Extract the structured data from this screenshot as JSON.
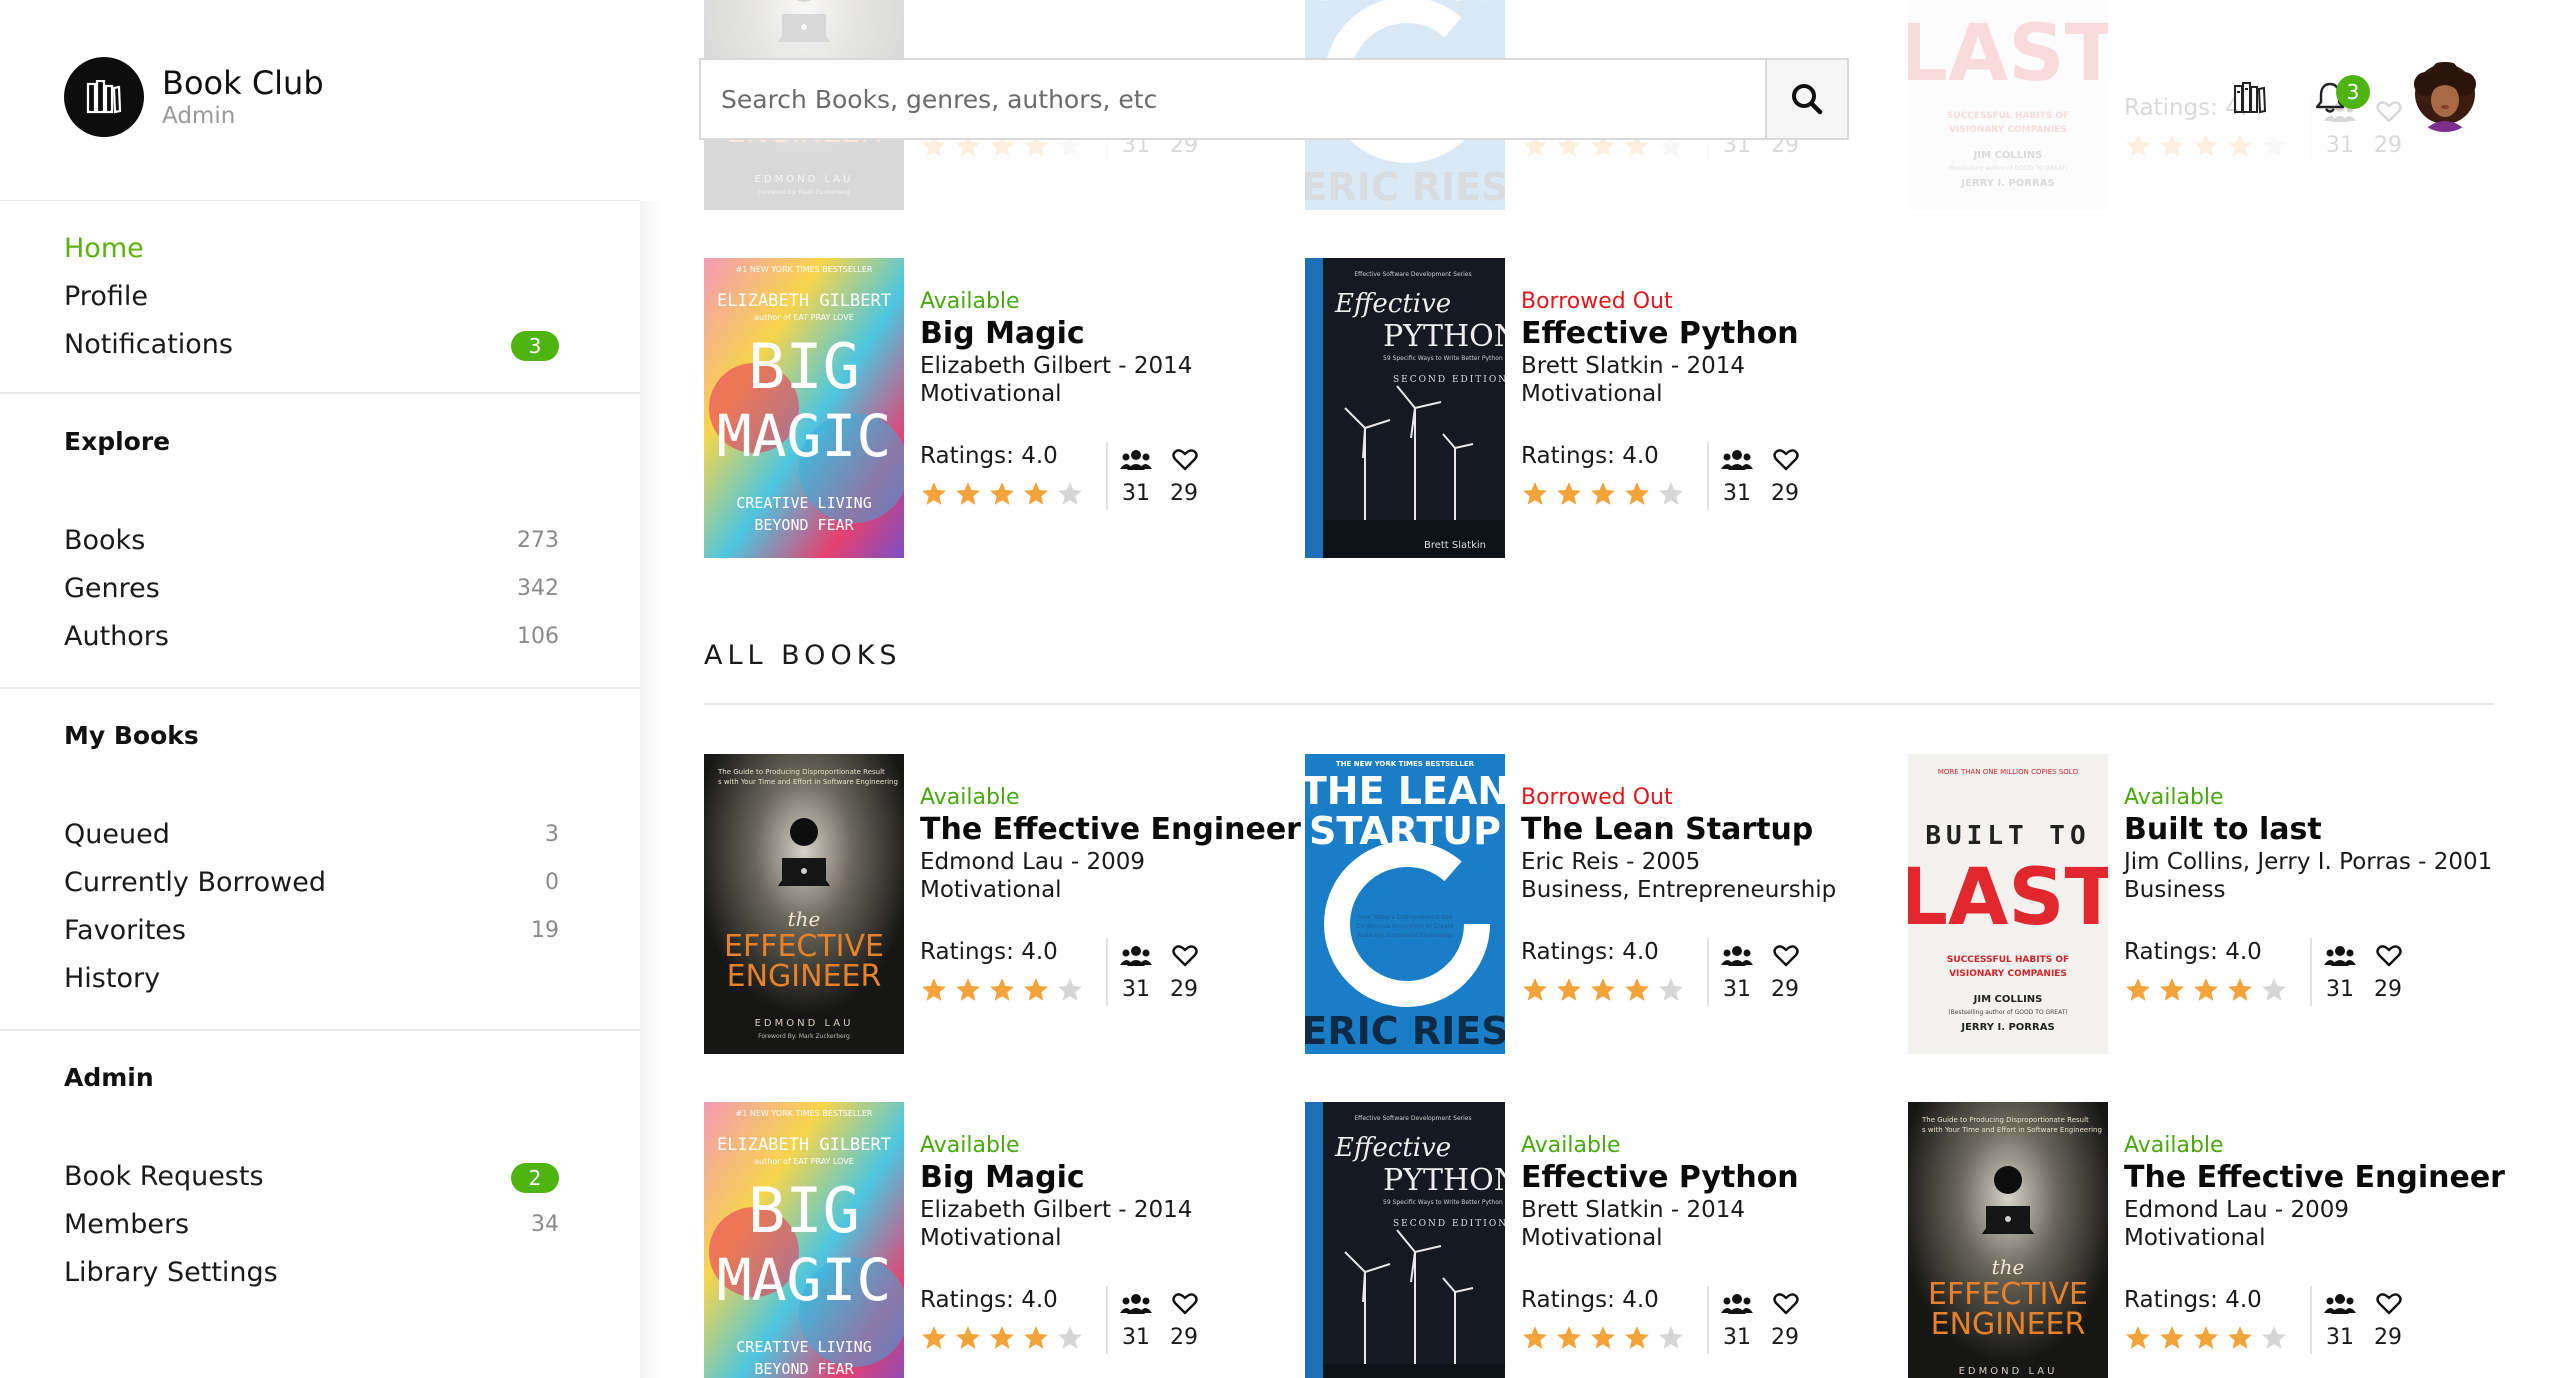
{
  "brand": {
    "name": "Book Club",
    "role": "Admin"
  },
  "search": {
    "placeholder": "Search Books, genres, authors, etc"
  },
  "header": {
    "notification_badge": "3"
  },
  "sidebar": {
    "main": [
      {
        "label": "Home",
        "active": true
      },
      {
        "label": "Profile"
      },
      {
        "label": "Notifications",
        "badge": "3"
      }
    ],
    "explore": {
      "heading": "Explore",
      "items": [
        {
          "label": "Books",
          "count": "273"
        },
        {
          "label": "Genres",
          "count": "342"
        },
        {
          "label": "Authors",
          "count": "106"
        }
      ]
    },
    "my_books": {
      "heading": "My Books",
      "items": [
        {
          "label": "Queued",
          "count": "3"
        },
        {
          "label": "Currently Borrowed",
          "count": "0"
        },
        {
          "label": "Favorites",
          "count": "19"
        },
        {
          "label": "History",
          "count": ""
        }
      ]
    },
    "admin": {
      "heading": "Admin",
      "items": [
        {
          "label": "Book Requests",
          "badge": "2"
        },
        {
          "label": "Members",
          "count": "34"
        },
        {
          "label": "Library Settings",
          "count": ""
        }
      ]
    }
  },
  "section": {
    "all_books": "ALL BOOKS"
  },
  "colors": {
    "accent": "#4fb310",
    "available": "#49a90c",
    "borrowed": "#e5171d",
    "star": "#f2a33a"
  },
  "books": [
    {
      "cover": "engineer",
      "status": "",
      "title": "",
      "author_year": "Edmond Lau - 2009",
      "genre": "Motivational",
      "ratings_label": "",
      "rating": 4,
      "borrows": "31",
      "likes": "29"
    },
    {
      "cover": "startup",
      "status": "",
      "title": "",
      "author_year": "Eric Reis - 2005",
      "genre": "Business, Entrepreneurship",
      "ratings_label": "",
      "rating": 4,
      "borrows": "31",
      "likes": "29"
    },
    {
      "cover": "last",
      "status": "",
      "title": "",
      "author_year": "Jim Collins, Jerry I. Porras - 2001",
      "genre": "Business",
      "ratings_label": "Ratings: 4.",
      "rating": 4,
      "borrows": "31",
      "likes": "29"
    },
    {
      "cover": "magic",
      "status": "Available",
      "status_type": "available",
      "title": "Big Magic",
      "author_year": "Elizabeth Gilbert - 2014",
      "genre": "Motivational",
      "ratings_label": "Ratings: 4.0",
      "rating": 4,
      "borrows": "31",
      "likes": "29"
    },
    {
      "cover": "python",
      "status": "Borrowed Out",
      "status_type": "out",
      "title": "Effective Python",
      "author_year": "Brett Slatkin - 2014",
      "genre": "Motivational",
      "ratings_label": "Ratings: 4.0",
      "rating": 4,
      "borrows": "31",
      "likes": "29"
    },
    {
      "cover": "engineer",
      "status": "Available",
      "status_type": "available",
      "title": "The Effective Engineer",
      "author_year": "Edmond Lau - 2009",
      "genre": "Motivational",
      "ratings_label": "Ratings: 4.0",
      "rating": 4,
      "borrows": "31",
      "likes": "29"
    },
    {
      "cover": "startup",
      "status": "Borrowed Out",
      "status_type": "out",
      "title": "The Lean Startup",
      "author_year": "Eric Reis - 2005",
      "genre": "Business, Entrepreneurship",
      "ratings_label": "Ratings: 4.0",
      "rating": 4,
      "borrows": "31",
      "likes": "29"
    },
    {
      "cover": "last",
      "status": "Available",
      "status_type": "available",
      "title": "Built to last",
      "author_year": "Jim Collins, Jerry I. Porras - 2001",
      "genre": "Business",
      "ratings_label": "Ratings: 4.0",
      "rating": 4,
      "borrows": "31",
      "likes": "29"
    },
    {
      "cover": "magic",
      "status": "Available",
      "status_type": "available",
      "title": "Big Magic",
      "author_year": "Elizabeth Gilbert - 2014",
      "genre": "Motivational",
      "ratings_label": "Ratings: 4.0",
      "rating": 4,
      "borrows": "31",
      "likes": "29"
    },
    {
      "cover": "python",
      "status": "Available",
      "status_type": "available",
      "title": "Effective Python",
      "author_year": "Brett Slatkin - 2014",
      "genre": "Motivational",
      "ratings_label": "Ratings: 4.0",
      "rating": 4,
      "borrows": "31",
      "likes": "29"
    },
    {
      "cover": "engineer",
      "status": "Available",
      "status_type": "available",
      "title": "The Effective Engineer",
      "author_year": "Edmond Lau - 2009",
      "genre": "Motivational",
      "ratings_label": "Ratings: 4.0",
      "rating": 4,
      "borrows": "31",
      "likes": "29"
    }
  ],
  "cover_text": {
    "engineer": {
      "top": "The Guide to Producing Disproportionate Results with Your Time and Effort in Software Engineering",
      "the": "the",
      "l1": "EFFECTIVE",
      "l2": "ENGINEER",
      "author": "EDMOND LAU",
      "foreword": "Foreword By: Mark Zuckerberg"
    },
    "startup": {
      "top": "THE NEW YORK TIMES BESTSELLER",
      "l1": "THE LEAN",
      "l2": "STARTUP",
      "mid": "How Today's Entrepreneurs Use Continuous Innovation to Create Radically Successful Businesses",
      "author": "ERIC RIES"
    },
    "last": {
      "top": "MORE THAN ONE MILLION COPIES SOLD",
      "l1": "BUILT TO",
      "l2": "LAST",
      "sub1": "SUCCESSFUL HABITS OF",
      "sub2": "VISIONARY COMPANIES",
      "a1": "JIM COLLINS",
      "a2": "(Bestselling author of GOOD TO GREAT)",
      "a3": "JERRY I. PORRAS"
    },
    "magic": {
      "top": "#1 NEW YORK TIMES BESTSELLER",
      "author": "ELIZABETH GILBERT",
      "sub": "author of EAT PRAY LOVE",
      "l1": "BIG",
      "l2": "MAGIC",
      "s1": "CREATIVE LIVING",
      "s2": "BEYOND FEAR"
    },
    "python": {
      "series": "Effective Software Development Series",
      "l1": "Effective",
      "l2": "PYTHON",
      "sub": "59 Specific Ways to Write Better Python",
      "ed": "SECOND EDITION",
      "author": "Brett Slatkin"
    }
  }
}
